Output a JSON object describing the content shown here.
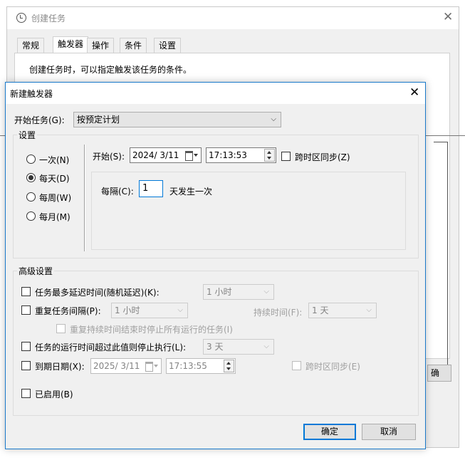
{
  "background_window": {
    "title": "创建任务",
    "close_glyph": "✕",
    "tabs": [
      {
        "label": "常规"
      },
      {
        "label": "触发器"
      },
      {
        "label": "操作"
      },
      {
        "label": "条件"
      },
      {
        "label": "设置"
      }
    ],
    "active_tab": "触发器",
    "description": "创建任务时，可以指定触发该任务的条件。",
    "ok_stub": "确"
  },
  "dialog": {
    "title": "新建触发器",
    "close_glyph": "✕",
    "begin_task": {
      "label": "开始任务(G):",
      "value": "按预定计划",
      "chevron": "⌵"
    },
    "settings": {
      "group_title": "设置",
      "schedule_options": [
        {
          "label": "一次(N)",
          "selected": false
        },
        {
          "label": "每天(D)",
          "selected": true
        },
        {
          "label": "每周(W)",
          "selected": false
        },
        {
          "label": "每月(M)",
          "selected": false
        }
      ],
      "start_label": "开始(S):",
      "start_date": "2024/ 3/11",
      "start_time": "17:13:53",
      "sync_timezone_label": "跨时区同步(Z)",
      "sync_timezone_checked": false,
      "recur_label": "每隔(C):",
      "recur_value": "1",
      "recur_suffix": "天发生一次"
    },
    "advanced": {
      "group_title": "高级设置",
      "delay": {
        "label": "任务最多延迟时间(随机延迟)(K):",
        "checked": false,
        "value": "1 小时"
      },
      "repeat": {
        "label": "重复任务间隔(P):",
        "checked": false,
        "value": "1 小时"
      },
      "duration": {
        "label": "持续时间(F):",
        "value": "1 天"
      },
      "stop_all": {
        "label": "重复持续时间结束时停止所有运行的任务(I)",
        "checked": false
      },
      "exceed": {
        "label": "任务的运行时间超过此值则停止执行(L):",
        "checked": false,
        "value": "3 天"
      },
      "expire": {
        "label": "到期日期(X):",
        "checked": false,
        "date": "2025/ 3/11",
        "time": "17:13:55"
      },
      "expire_sync": {
        "label": "跨时区同步(E)",
        "checked": false
      },
      "enabled": {
        "label": "已启用(B)",
        "checked": false
      }
    },
    "buttons": {
      "ok": "确定",
      "cancel": "取消"
    }
  }
}
